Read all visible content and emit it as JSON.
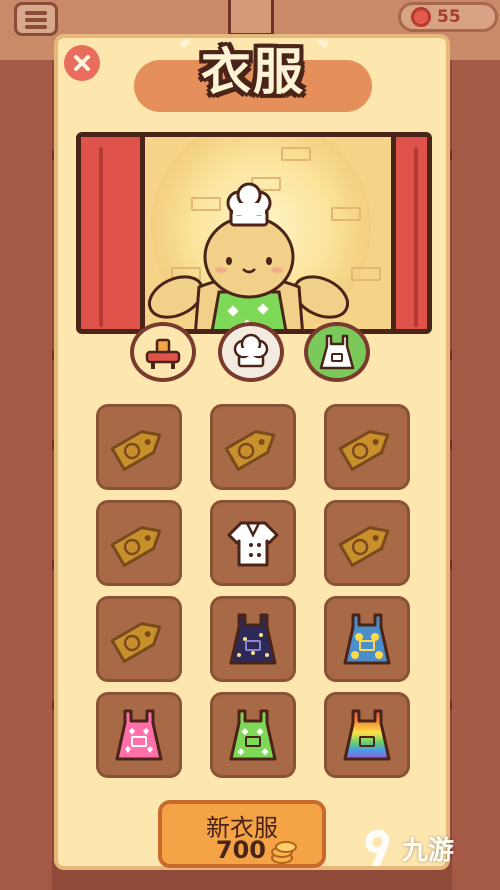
{
  "hud": {
    "hearts_count": "55",
    "menu_icon": "menu-icon",
    "heart_icon": "heart-coin-icon"
  },
  "dialog": {
    "title": "衣服",
    "close_icon": "close-icon"
  },
  "preview": {
    "character": "bunny-chef",
    "wearing": [
      "chef-hat",
      "green-heart-apron"
    ]
  },
  "categories": [
    {
      "id": "furniture",
      "icon": "picnic-table-icon",
      "selected": false
    },
    {
      "id": "hats",
      "icon": "chef-hat-icon",
      "selected": false
    },
    {
      "id": "clothes",
      "icon": "apron-icon",
      "selected": true
    }
  ],
  "items": [
    {
      "state": "locked",
      "icon": "price-tag-icon"
    },
    {
      "state": "locked",
      "icon": "price-tag-icon"
    },
    {
      "state": "locked",
      "icon": "price-tag-icon"
    },
    {
      "state": "locked",
      "icon": "price-tag-icon"
    },
    {
      "state": "owned",
      "icon": "chef-jacket-icon"
    },
    {
      "state": "locked",
      "icon": "price-tag-icon"
    },
    {
      "state": "locked",
      "icon": "price-tag-icon"
    },
    {
      "state": "owned",
      "icon": "starry-night-apron-icon",
      "color": "#2d2a5a"
    },
    {
      "state": "owned",
      "icon": "yellow-flower-apron-icon",
      "color": "#4a8fc9"
    },
    {
      "state": "owned",
      "icon": "pink-heart-apron-icon",
      "color": "#ff6fa8"
    },
    {
      "state": "owned",
      "icon": "green-check-apron-icon",
      "color": "#7ed957"
    },
    {
      "state": "owned",
      "icon": "rainbow-apron-icon",
      "color": "#e84a4a"
    }
  ],
  "buy_button": {
    "label": "新衣服",
    "price": "700",
    "currency_icon": "coin-stack-icon"
  },
  "watermark": {
    "text": "九游",
    "logo": "jiuyou-logo"
  },
  "colors": {
    "panel": "#fde7ae",
    "panel_border": "#e8b87a",
    "cell": "#a86a46",
    "title_pill": "#e5905b",
    "buy": "#f4a446",
    "close": "#e86d5c"
  }
}
